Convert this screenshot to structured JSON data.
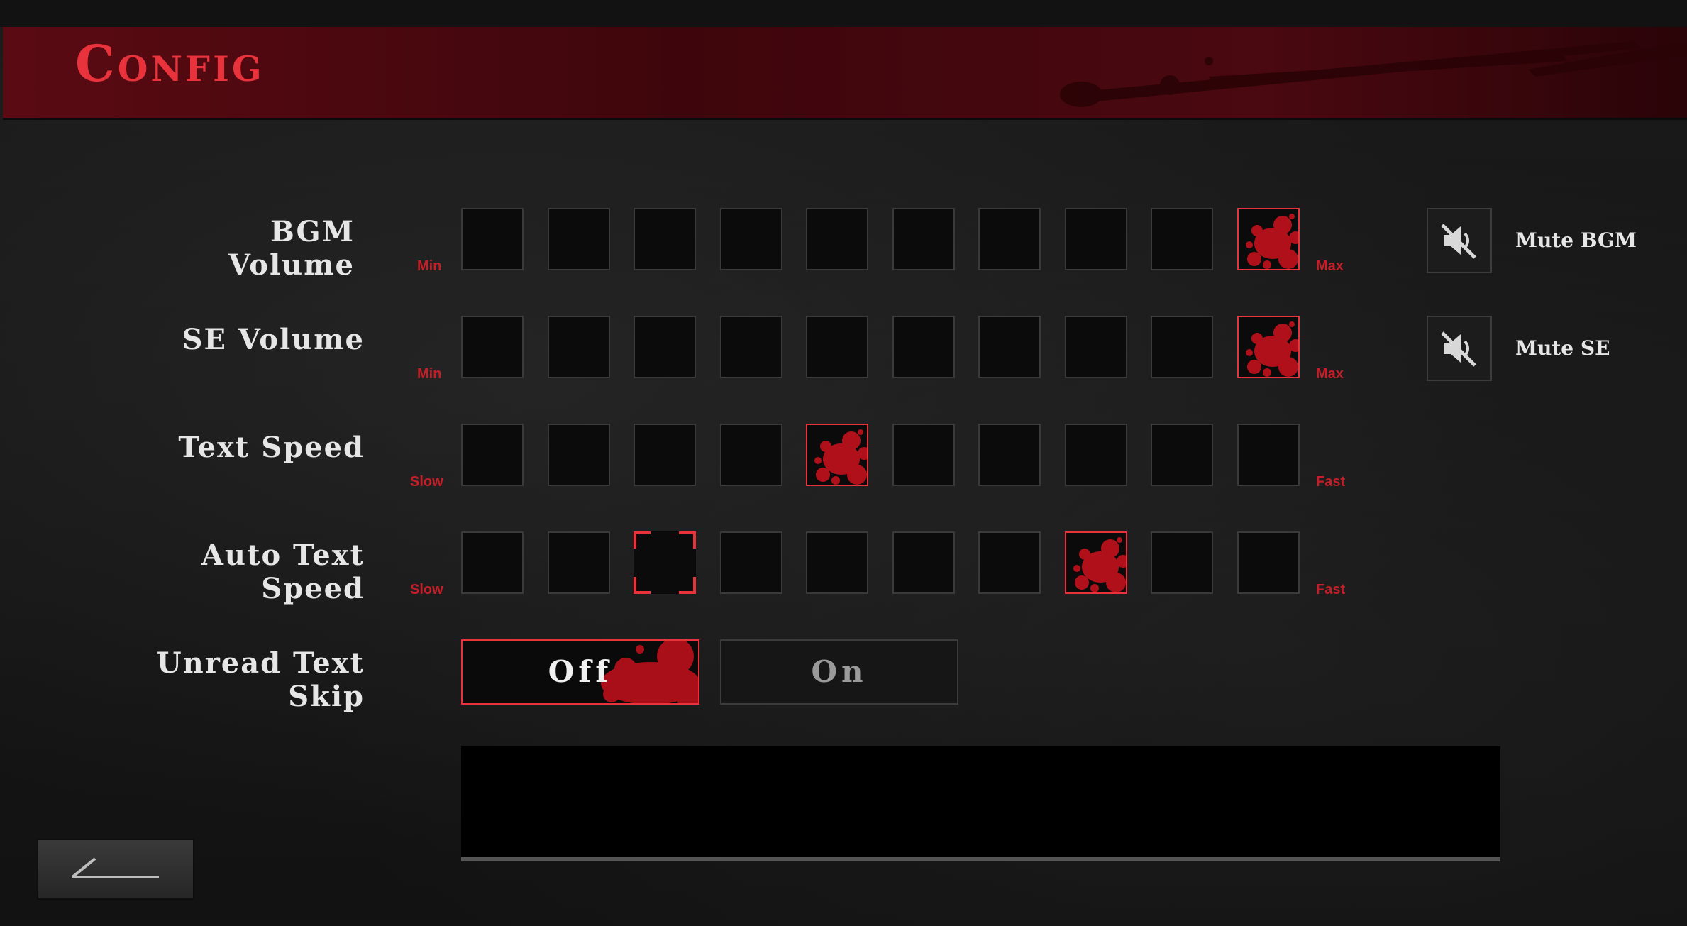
{
  "header": {
    "title": "Config"
  },
  "settings": {
    "bgm": {
      "label": "BGM Volume",
      "min_label": "Min",
      "max_label": "Max",
      "steps": 10,
      "selected_step": 10,
      "mute_label": "Mute BGM"
    },
    "se": {
      "label": "SE Volume",
      "min_label": "Min",
      "max_label": "Max",
      "steps": 10,
      "selected_step": 10,
      "mute_label": "Mute SE"
    },
    "text_speed": {
      "label": "Text Speed",
      "min_label": "Slow",
      "max_label": "Fast",
      "steps": 10,
      "selected_step": 5
    },
    "auto_text_speed": {
      "label": "Auto Text Speed",
      "min_label": "Slow",
      "max_label": "Fast",
      "steps": 10,
      "selected_step": 8,
      "hover_step": 3
    },
    "unread_skip": {
      "label": "Unread Text Skip",
      "options": [
        "Off",
        "On"
      ],
      "selected": "Off"
    }
  },
  "icons": {
    "mute": "speaker-muted-icon",
    "back": "back-arrow-icon",
    "selected_marker": "blood-splatter-icon"
  },
  "colors": {
    "accent": "#e8323c",
    "header_bg": "#4a0810",
    "splatter": "#b0101a"
  }
}
